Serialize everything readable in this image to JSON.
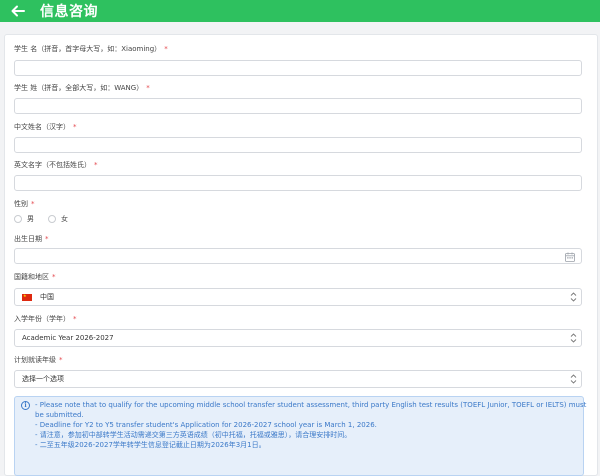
{
  "header": {
    "title": "信息咨询"
  },
  "form": {
    "first_name": {
      "label": "学生 名（拼音，首字母大写，如：Xiaoming）",
      "required": "*",
      "value": ""
    },
    "last_name": {
      "label": "学生 姓（拼音，全部大写，如：WANG）",
      "required": "*",
      "value": ""
    },
    "chinese_name": {
      "label": "中文姓名（汉字）",
      "required": "*",
      "value": ""
    },
    "english_name": {
      "label": "英文名字（不包括姓氏）",
      "required": "*",
      "value": ""
    },
    "gender": {
      "label": "性别",
      "required": "*",
      "options": [
        "男",
        "女"
      ]
    },
    "birthdate": {
      "label": "出生日期",
      "required": "*",
      "value": ""
    },
    "nationality": {
      "label": "国籍和地区",
      "required": "*",
      "value": "中国"
    },
    "entry_year": {
      "label": "入学年份（学年）",
      "required": "*",
      "value": "Academic Year 2026-2027"
    },
    "grade": {
      "label": "计划就读年级",
      "required": "*",
      "value": "选择一个选项"
    }
  },
  "notice": {
    "lines": [
      "- Please note that to qualify for the upcoming middle school transfer student assessment, third party English test results (TOEFL Junior, TOEFL or IELTS) must",
      "  be submitted.",
      "- Deadline for Y2 to Y5 transfer student's Application for 2026-2027 school year is March 1, 2026.",
      "- 请注意，参加初中部转学生活动需递交第三方英语成绩（初中托福，托福或雅思），请合理安排时间。",
      "- 二至五年级2026-2027学年转学生信息登记截止日期为2026年3月1日。"
    ]
  },
  "colors": {
    "header": "#2ec15f",
    "required": "#e5484d",
    "notice_text": "#3a78c8",
    "notice_bg": "#e6effa"
  }
}
